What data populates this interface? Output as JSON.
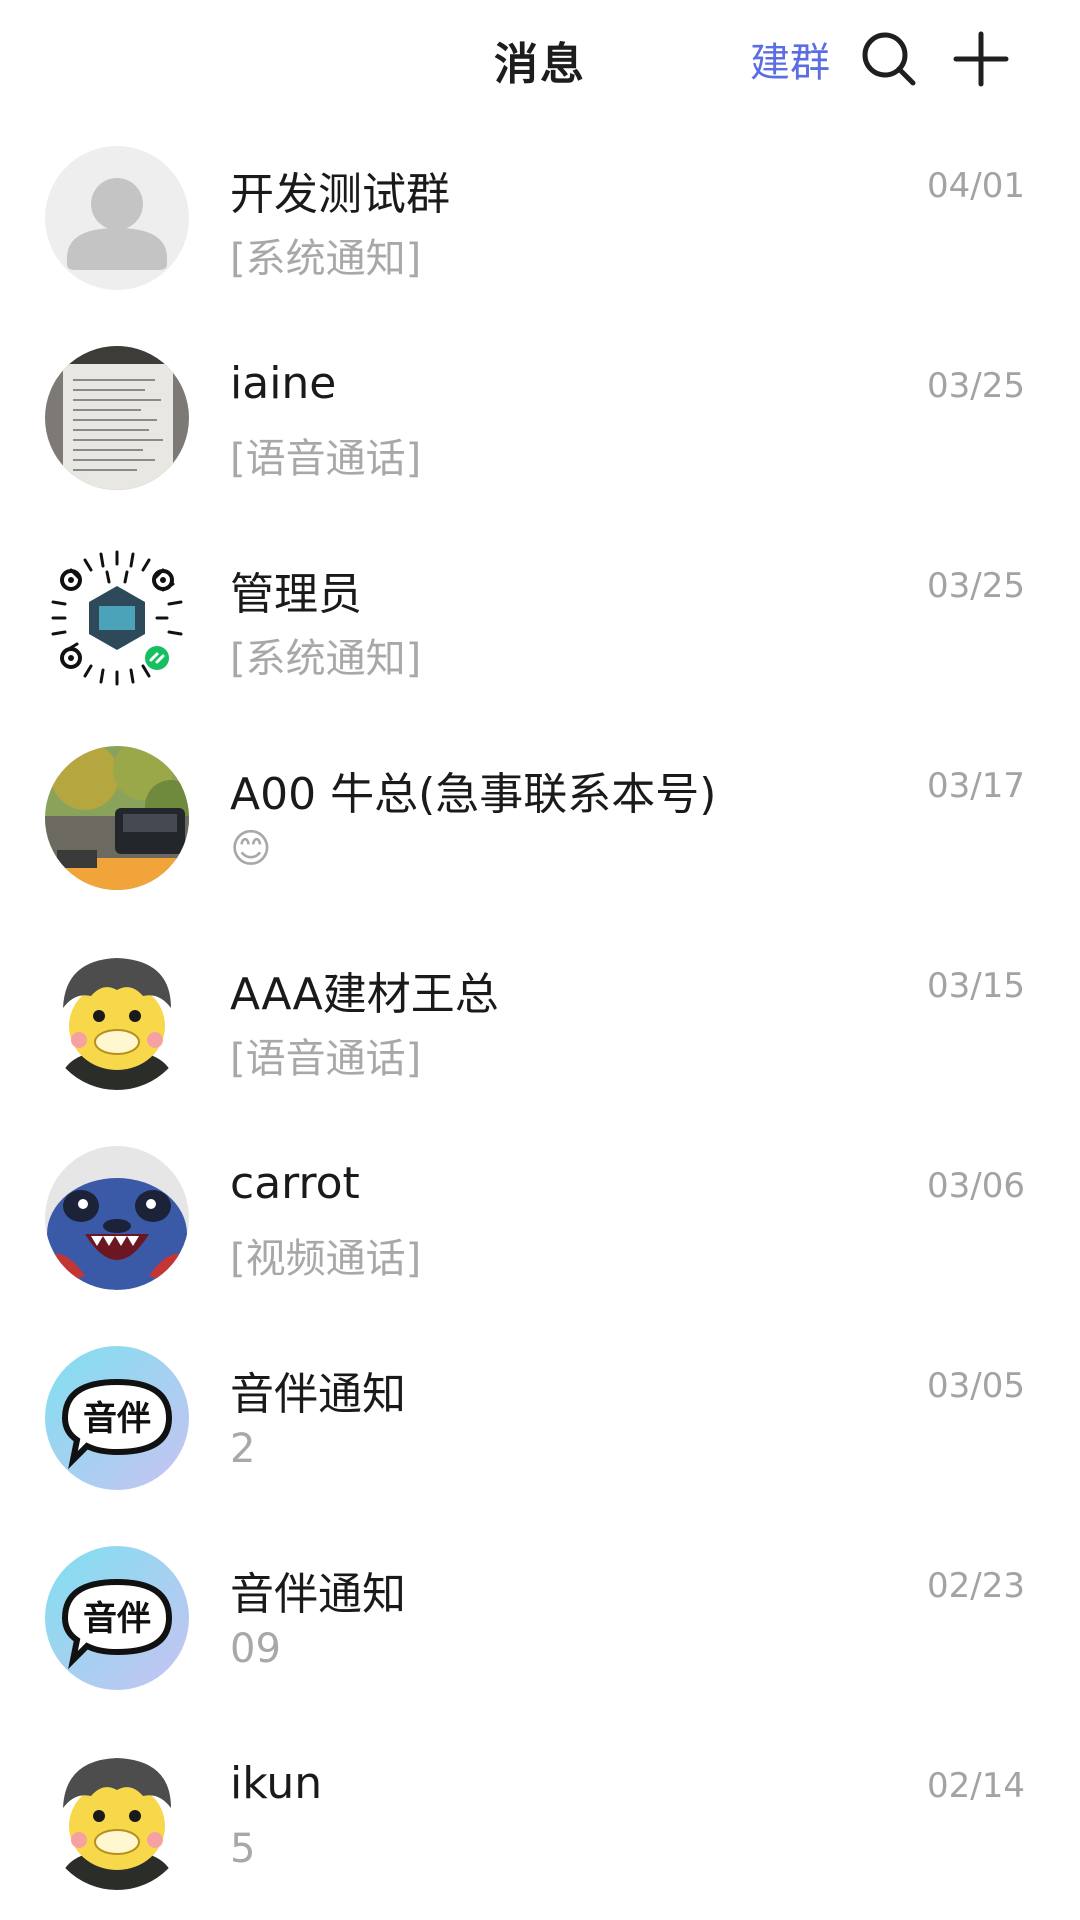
{
  "header": {
    "title": "消息",
    "create_group_label": "建群",
    "search_icon": "search-icon",
    "add_icon": "plus-icon"
  },
  "colors": {
    "accent": "#5b6ee1",
    "name_text": "#1a1a1a",
    "preview_text": "#a8a8a8"
  },
  "conversations": [
    {
      "name": "开发测试群",
      "preview": "[系统通知]",
      "date": "04/01",
      "avatar": "default-person-avatar"
    },
    {
      "name": "iaine",
      "preview": "[语音通话]",
      "date": "03/25",
      "avatar": "document-photo-avatar"
    },
    {
      "name": "管理员",
      "preview": "[系统通知]",
      "date": "03/25",
      "avatar": "qr-code-avatar"
    },
    {
      "name": "A00 牛总(急事联系本号)",
      "preview": "😊",
      "date": "03/17",
      "avatar": "street-photo-avatar"
    },
    {
      "name": "AAA建材王总",
      "preview": "[语音通话]",
      "date": "03/15",
      "avatar": "duck-cartoon-avatar"
    },
    {
      "name": "carrot",
      "preview": "[视频通话]",
      "date": "03/06",
      "avatar": "stitch-cartoon-avatar"
    },
    {
      "name": "音伴通知",
      "preview": "2",
      "date": "03/05",
      "avatar": "yinban-logo-avatar",
      "avatar_text": "音伴"
    },
    {
      "name": "音伴通知",
      "preview": "09",
      "date": "02/23",
      "avatar": "yinban-logo-avatar",
      "avatar_text": "音伴"
    },
    {
      "name": "ikun",
      "preview": "5",
      "date": "02/14",
      "avatar": "duck-cartoon-avatar"
    }
  ]
}
